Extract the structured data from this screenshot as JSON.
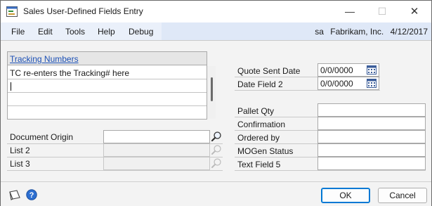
{
  "window": {
    "title": "Sales User-Defined Fields Entry",
    "controls": {
      "minimize": "—",
      "maximize": "☐",
      "close": "✕"
    }
  },
  "menu": {
    "items": [
      "File",
      "Edit",
      "Tools",
      "Help",
      "Debug"
    ],
    "status": {
      "user": "sa",
      "company": "Fabrikam, Inc.",
      "date": "4/12/2017"
    }
  },
  "tracking": {
    "header": "Tracking Numbers",
    "rows": [
      "TC re-enters the Tracking# here",
      "",
      "",
      ""
    ]
  },
  "left_fields": [
    {
      "label": "Document Origin",
      "value": "",
      "lookup_icon": "magnifier-icon"
    },
    {
      "label": "List 2",
      "value": "",
      "lookup_icon": "lookup-icon"
    },
    {
      "label": "List 3",
      "value": "",
      "lookup_icon": "lookup-icon"
    }
  ],
  "date_fields": [
    {
      "label": "Quote Sent Date",
      "value": "0/0/0000",
      "icon": "calendar-icon"
    },
    {
      "label": "Date Field 2",
      "value": "0/0/0000",
      "icon": "calendar-icon"
    }
  ],
  "right_fields": [
    {
      "label": "Pallet Qty",
      "value": ""
    },
    {
      "label": "Confirmation",
      "value": ""
    },
    {
      "label": "Ordered by",
      "value": ""
    },
    {
      "label": "MOGen Status",
      "value": ""
    },
    {
      "label": "Text Field 5",
      "value": ""
    }
  ],
  "footer": {
    "ok": "OK",
    "cancel": "Cancel"
  },
  "colors": {
    "menubar": "#dfe8f7",
    "link": "#1a4fb5",
    "primary_border": "#0078d4"
  }
}
